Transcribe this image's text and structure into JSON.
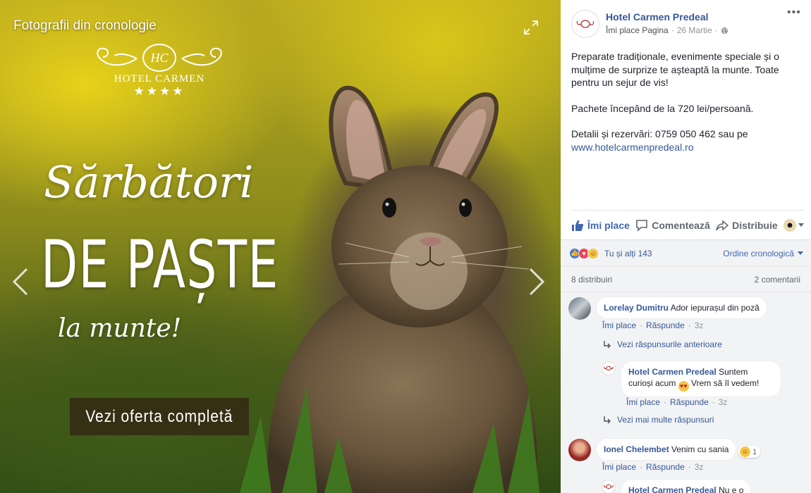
{
  "photo": {
    "title": "Fotografii din cronologie",
    "logo": {
      "monogram": "HC",
      "name": "HOTEL CARMEN",
      "stars": "★★★★"
    },
    "promo": {
      "line1": "Sărbători",
      "line2": "DE PAȘTE",
      "line3": "la munte!"
    },
    "offer_button": "Vezi oferta completă"
  },
  "post": {
    "page_name": "Hotel Carmen Predeal",
    "like_page": "Îmi place Pagina",
    "date": "26 Martie",
    "separator": "·",
    "paragraph1": "Preparate tradiționale, evenimente speciale și o mulțime de surprize te așteaptă la munte. Toate pentru un sejur de vis!",
    "paragraph2": "Pachete începând de la 720 lei/persoană.",
    "paragraph3": "Detalii și rezervări: 0759 050 462 sau pe",
    "link": "www.hotelcarmenpredeal.ro"
  },
  "actions": {
    "like": "Îmi place",
    "comment": "Comentează",
    "share": "Distribuie"
  },
  "reactions": {
    "summary": "Tu și alți 143",
    "order": "Ordine cronologică"
  },
  "stats": {
    "shares": "8 distribuiri",
    "comments": "2 comentarii"
  },
  "comments": [
    {
      "author": "Lorelay Dumitru",
      "text": "Ador iepurașul din poză",
      "like": "Îmi place",
      "reply": "Răspunde",
      "time": "3z"
    },
    {
      "author": "Hotel Carmen Predeal",
      "text_before": "Suntem curioși acum",
      "text_after": "Vrem să îl vedem!",
      "like": "Îmi place",
      "reply": "Răspunde",
      "time": "3z"
    },
    {
      "author": "Ionel Chelembet",
      "text": "Venim cu sania",
      "reaction_count": "1",
      "like": "Îmi place",
      "reply": "Răspunde",
      "time": "3z"
    },
    {
      "author": "Hotel Carmen Predeal",
      "text": "Nu e o"
    }
  ],
  "replies": {
    "previous": "Vezi răspunsurile anterioare",
    "more": "Vezi mai multe răspunsuri"
  },
  "colors": {
    "link": "#365899",
    "accent": "#4267b2",
    "secondary_text": "#90949c"
  }
}
